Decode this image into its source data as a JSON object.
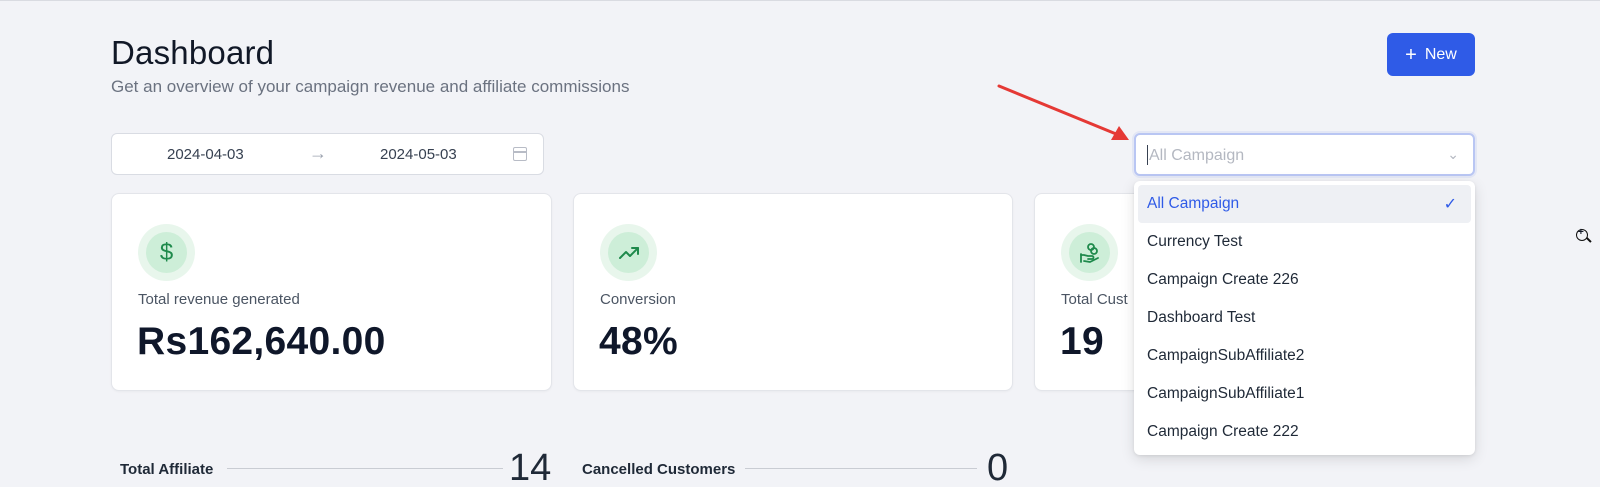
{
  "header": {
    "title": "Dashboard",
    "subtitle": "Get an overview of your campaign revenue and affiliate commissions",
    "new_button_label": "New"
  },
  "date_range": {
    "start": "2024-04-03",
    "end": "2024-05-03"
  },
  "campaign_select": {
    "placeholder": "All Campaign",
    "selected": "All Campaign",
    "options": [
      "All Campaign",
      "Currency Test",
      "Campaign Create 226",
      "Dashboard Test",
      "CampaignSubAffiliate2",
      "CampaignSubAffiliate1",
      "Campaign Create 222"
    ]
  },
  "cards": [
    {
      "label": "Total revenue generated",
      "value": "Rs162,640.00",
      "icon": "dollar-icon"
    },
    {
      "label": "Conversion",
      "value": "48%",
      "icon": "trending-up-icon"
    },
    {
      "label": "Total Cust",
      "value": "19",
      "icon": "hand-coins-icon"
    }
  ],
  "stats": [
    {
      "label": "Total Affiliate",
      "value": "14"
    },
    {
      "label": "Cancelled Customers",
      "value": "0"
    }
  ],
  "colors": {
    "accent": "#2f5be7",
    "icon_green": "#1f8a4c",
    "annotation_arrow": "#e53935"
  }
}
